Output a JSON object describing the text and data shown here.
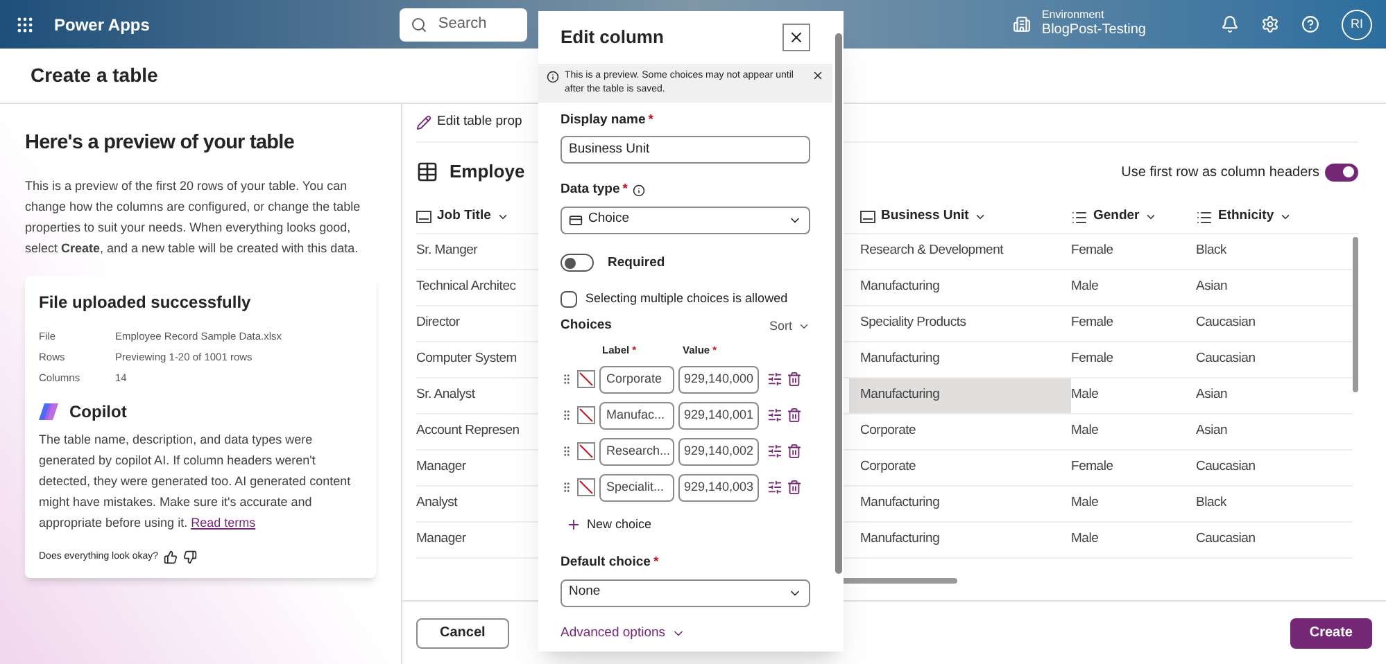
{
  "app": {
    "name": "Power Apps"
  },
  "search": {
    "placeholder": "Search"
  },
  "environment": {
    "label": "Environment",
    "name": "BlogPost-Testing"
  },
  "user": {
    "initials": "RI"
  },
  "page_title": "Create a table",
  "preview": {
    "heading": "Here's a preview of your table",
    "description": "This is a preview of the first 20 rows of your table. You can change how the columns are configured, or change the table properties to suit your needs. When everything looks good, select **Create**, and a new table will be created with this data.",
    "file_card": {
      "title": "File uploaded successfully",
      "details": [
        {
          "label": "File",
          "value": "Employee Record Sample Data.xlsx"
        },
        {
          "label": "Rows",
          "value": "Previewing 1-20 of 1001 rows"
        },
        {
          "label": "Columns",
          "value": "14"
        }
      ]
    },
    "copilot": {
      "title": "Copilot",
      "text": "The table name, description, and data types were generated by copilot AI. If column headers weren't detected, they were generated too. AI generated content might have mistakes. Make sure it's accurate and appropriate before using it.",
      "link": "Read terms"
    },
    "feedback": {
      "question": "Does everything look okay?"
    }
  },
  "table": {
    "edit_properties": "Edit table prop",
    "name": "Employe",
    "header_toggle": {
      "label": "Use first row as column headers",
      "on": true
    },
    "columns": [
      {
        "label": "Job Title",
        "kind": "text"
      },
      {
        "label": "Business Unit",
        "kind": "text"
      },
      {
        "label": "Gender",
        "kind": "choice"
      },
      {
        "label": "Ethnicity",
        "kind": "choice"
      }
    ],
    "rows": [
      {
        "cells": [
          {
            "text": "Sr. Manger",
            "selected": false
          },
          {
            "text": "Research & Development",
            "selected": false
          },
          {
            "text": "Female",
            "selected": false
          },
          {
            "text": "Black",
            "selected": false
          }
        ]
      },
      {
        "cells": [
          {
            "text": "Technical Architec",
            "selected": false
          },
          {
            "text": "Manufacturing",
            "selected": false
          },
          {
            "text": "Male",
            "selected": false
          },
          {
            "text": "Asian",
            "selected": false
          }
        ]
      },
      {
        "cells": [
          {
            "text": "Director",
            "selected": false
          },
          {
            "text": "Speciality Products",
            "selected": false
          },
          {
            "text": "Female",
            "selected": false
          },
          {
            "text": "Caucasian",
            "selected": false
          }
        ]
      },
      {
        "cells": [
          {
            "text": "Computer System",
            "selected": false
          },
          {
            "text": "Manufacturing",
            "selected": false
          },
          {
            "text": "Female",
            "selected": false
          },
          {
            "text": "Caucasian",
            "selected": false
          }
        ]
      },
      {
        "cells": [
          {
            "text": "Sr. Analyst",
            "selected": false
          },
          {
            "text": "Manufacturing",
            "selected": true
          },
          {
            "text": "Male",
            "selected": false
          },
          {
            "text": "Asian",
            "selected": false
          }
        ]
      },
      {
        "cells": [
          {
            "text": "Account Represen",
            "selected": false
          },
          {
            "text": "Corporate",
            "selected": false
          },
          {
            "text": "Male",
            "selected": false
          },
          {
            "text": "Asian",
            "selected": false
          }
        ]
      },
      {
        "cells": [
          {
            "text": "Manager",
            "selected": false
          },
          {
            "text": "Corporate",
            "selected": false
          },
          {
            "text": "Female",
            "selected": false
          },
          {
            "text": "Caucasian",
            "selected": false
          }
        ]
      },
      {
        "cells": [
          {
            "text": "Analyst",
            "selected": false
          },
          {
            "text": "Manufacturing",
            "selected": false
          },
          {
            "text": "Male",
            "selected": false
          },
          {
            "text": "Black",
            "selected": false
          }
        ]
      },
      {
        "cells": [
          {
            "text": "Manager",
            "selected": false
          },
          {
            "text": "Manufacturing",
            "selected": false
          },
          {
            "text": "Male",
            "selected": false
          },
          {
            "text": "Caucasian",
            "selected": false
          }
        ]
      }
    ]
  },
  "footer": {
    "cancel": "Cancel",
    "create": "Create"
  },
  "edit_panel": {
    "title": "Edit column",
    "notice": "This is a preview. Some choices may not appear until after the table is saved.",
    "display_name": {
      "label": "Display name",
      "required_mark": "*",
      "value": "Business Unit"
    },
    "data_type": {
      "label": "Data type",
      "required_mark": "*",
      "value": "Choice"
    },
    "required_toggle": {
      "label": "Required",
      "on": false
    },
    "multiple": {
      "label": "Selecting multiple choices is allowed",
      "checked": false
    },
    "choices": {
      "title": "Choices",
      "sort": "Sort",
      "label_header": "Label",
      "value_header": "Value",
      "required_mark": "*",
      "items": [
        {
          "label": "Corporate",
          "value": "929,140,000"
        },
        {
          "label": "Manufac...",
          "value": "929,140,001"
        },
        {
          "label": "Research...",
          "value": "929,140,002"
        },
        {
          "label": "Specialit...",
          "value": "929,140,003"
        }
      ],
      "new_choice": "New choice"
    },
    "default_choice": {
      "label": "Default choice",
      "required_mark": "*",
      "value": "None"
    },
    "advanced": "Advanced options"
  }
}
